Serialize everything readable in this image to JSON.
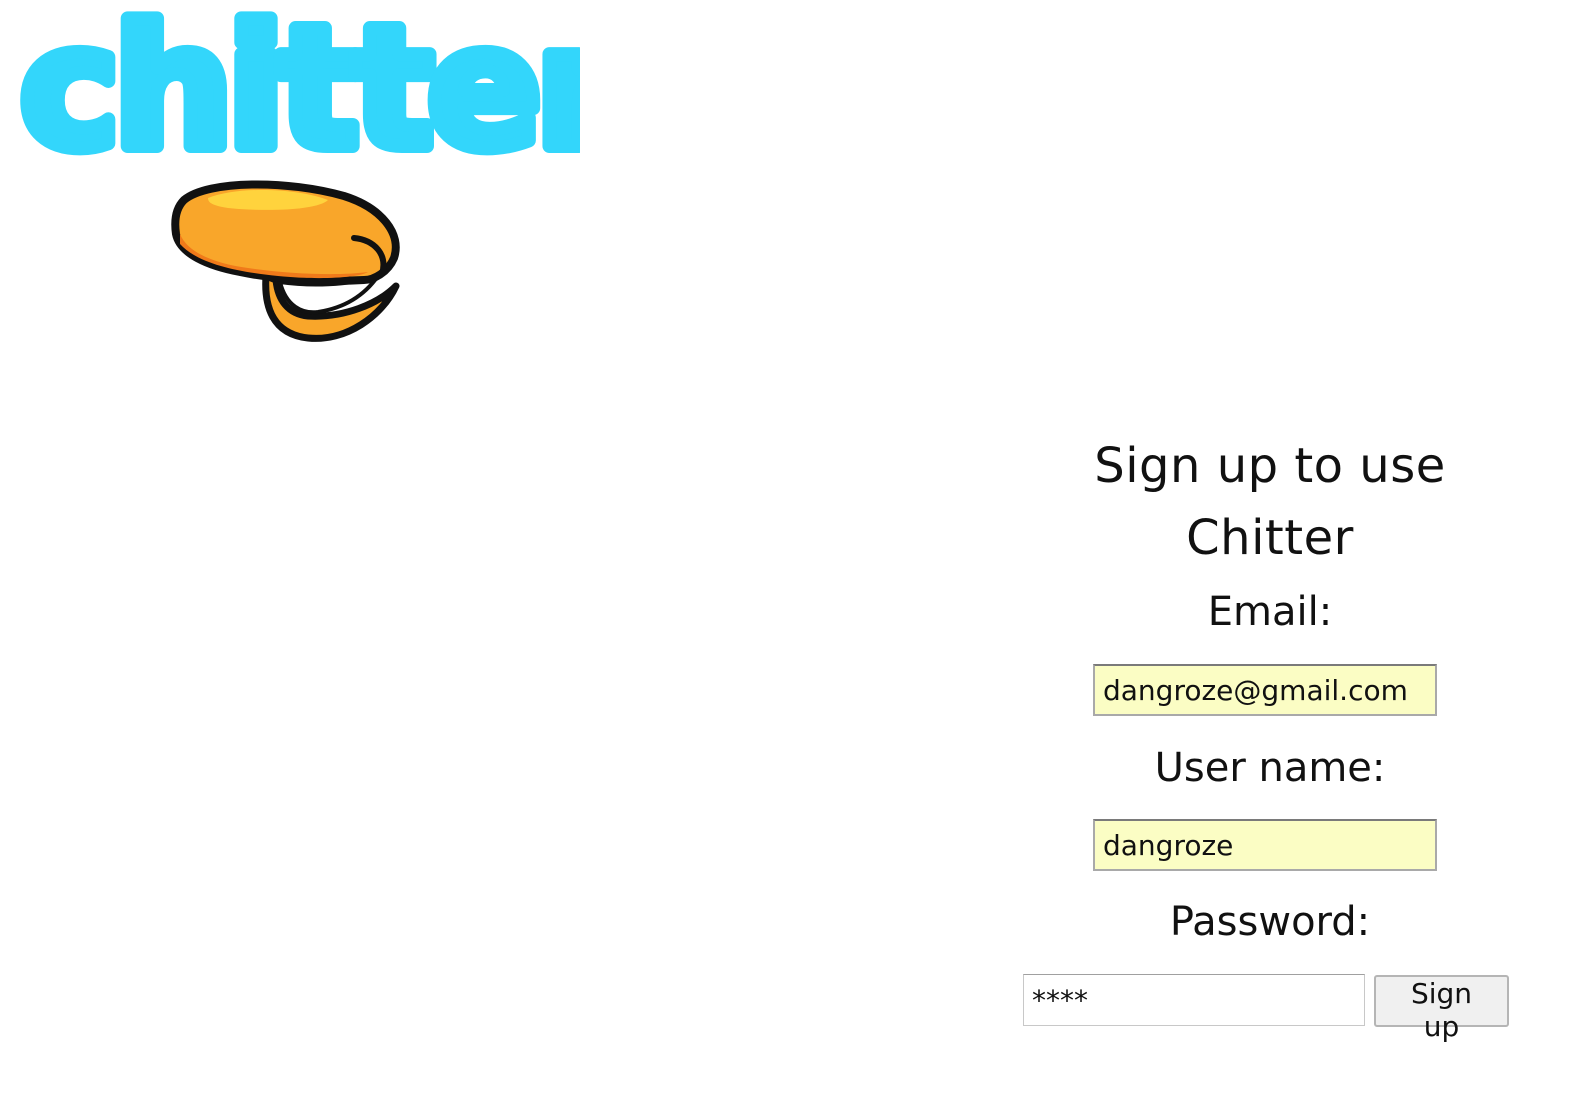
{
  "logo": {
    "text": "chitter",
    "colors": {
      "wordmark": "#33d6fb",
      "beak_light": "#ffd33d",
      "beak_main": "#f9a62a",
      "beak_dark": "#f07a1a",
      "outline": "#111111"
    }
  },
  "signup": {
    "title": "Sign up to use Chitter",
    "email": {
      "label": "Email:",
      "value": "dangroze@gmail.com"
    },
    "username": {
      "label": "User name:",
      "value": "dangroze"
    },
    "password": {
      "label": "Password:",
      "value": "****"
    },
    "submit_label": "Sign up"
  },
  "colors": {
    "autofill_background": "#fbfdc4",
    "text": "#111111",
    "button_background": "#f0f0f0"
  }
}
